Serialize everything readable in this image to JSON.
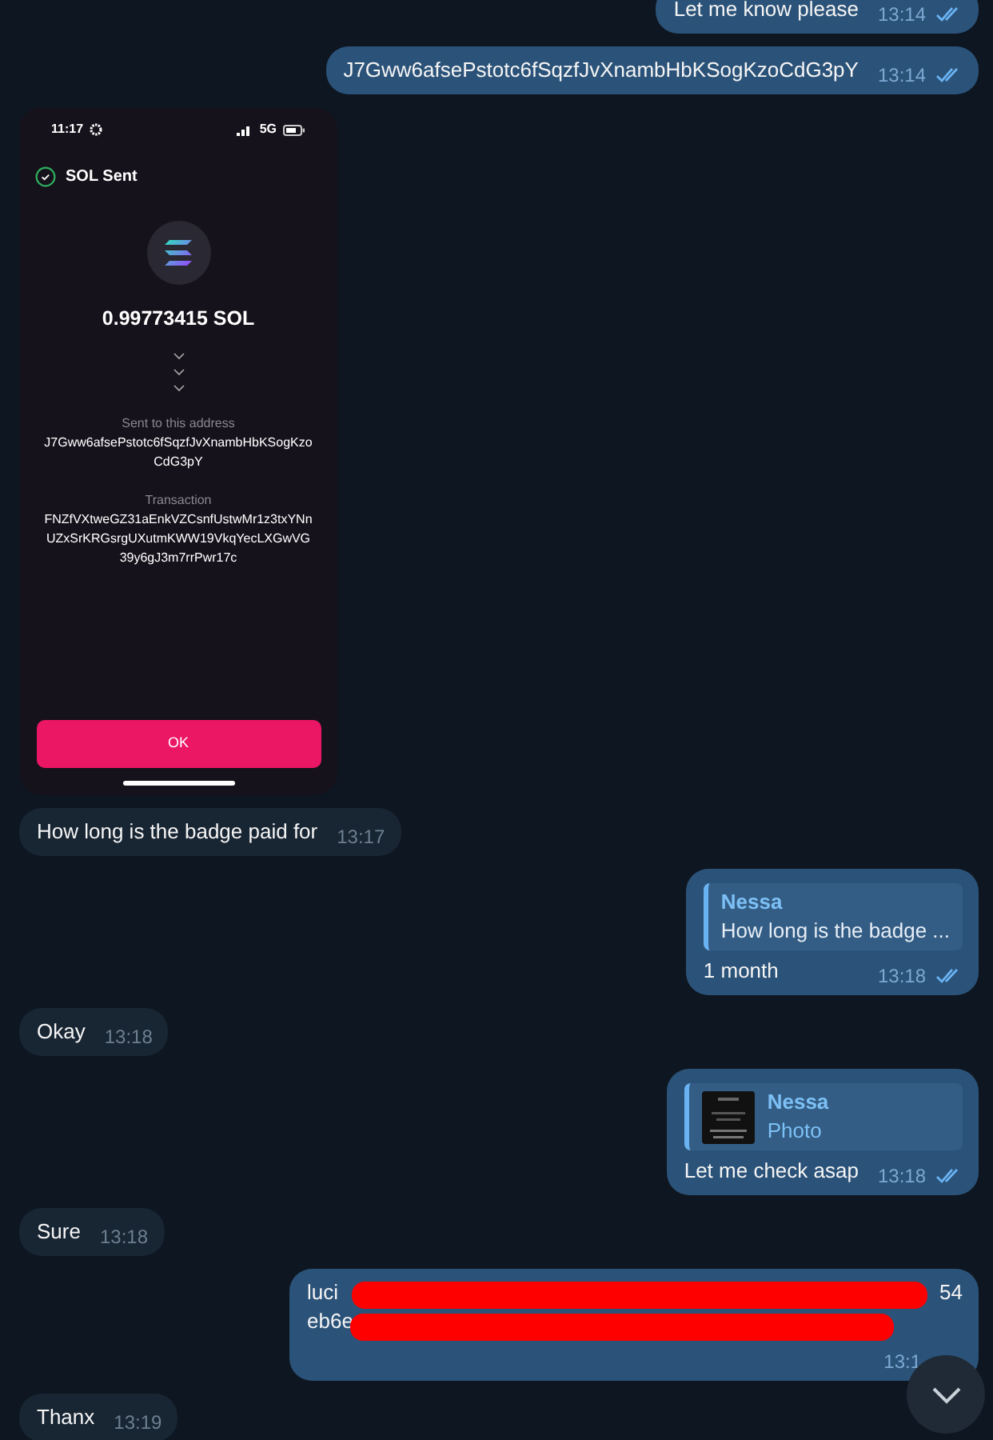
{
  "messages": [
    {
      "kind": "text",
      "outgoing": true,
      "text": "Let me know please",
      "time": "13:14",
      "read": true
    },
    {
      "kind": "text",
      "outgoing": true,
      "text": "J7Gww6afsePstotc6fSqzfJvXnambHbKSogKzoCdG3pY",
      "time": "13:14",
      "read": true
    },
    {
      "kind": "screenshot",
      "outgoing": false,
      "phone": {
        "clock": "11:17",
        "network": "5G",
        "title": "SOL Sent",
        "amount": "0.99773415 SOL",
        "address_label": "Sent to this address",
        "address": "J7Gww6afsePstotc6fSqzfJvXnambHbKSogKzoCdG3pY",
        "transaction_label": "Transaction",
        "transaction": "FNZfVXtweGZ31aEnkVZCsnfUstwMr1z3txYNnUZxSrKRGsrgUXutmKWW19VkqYecLXGwVG39y6gJ3m7rrPwr17c",
        "button": "OK"
      }
    },
    {
      "kind": "text",
      "outgoing": false,
      "text": "How long is the badge paid for",
      "time": "13:17"
    },
    {
      "kind": "reply",
      "outgoing": true,
      "reply_to": {
        "author": "Nessa",
        "text": "How long is the badge ..."
      },
      "text": "1 month",
      "time": "13:18",
      "read": true
    },
    {
      "kind": "text",
      "outgoing": false,
      "text": "Okay",
      "time": "13:18"
    },
    {
      "kind": "reply",
      "outgoing": true,
      "reply_to": {
        "author": "Nessa",
        "text": "Photo",
        "thumbnail": true
      },
      "text": "Let me check asap",
      "time": "13:18",
      "read": true
    },
    {
      "kind": "text",
      "outgoing": false,
      "text": "Sure",
      "time": "13:18"
    },
    {
      "kind": "redacted",
      "outgoing": true,
      "lines": [
        {
          "start": "luci",
          "end": "54"
        },
        {
          "start": "eb6e"
        }
      ],
      "time": "13:1"
    },
    {
      "kind": "text",
      "outgoing": false,
      "text": "Thanx",
      "time": "13:19"
    }
  ]
}
